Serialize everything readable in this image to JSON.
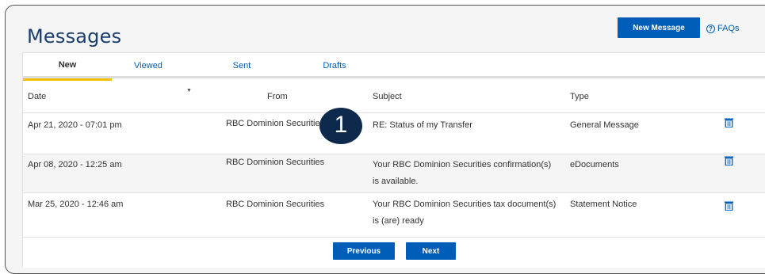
{
  "header": {
    "title": "Messages",
    "new_message_label": "New Message",
    "faq_label": "FAQs"
  },
  "tabs": [
    {
      "label": "New",
      "active": true
    },
    {
      "label": "Viewed",
      "active": false
    },
    {
      "label": "Sent",
      "active": false
    },
    {
      "label": "Drafts",
      "active": false
    }
  ],
  "table": {
    "columns": [
      "Date",
      "From",
      "Subject",
      "Type"
    ],
    "rows": [
      {
        "date": "Apr 21, 2020 - 07:01 pm",
        "from": "RBC Dominion Securities",
        "subject_line1": "RE: Status of my Transfer",
        "subject_line2": "",
        "type": "General Message"
      },
      {
        "date": "Apr 08, 2020 - 12:25 am",
        "from": "RBC Dominion Securities",
        "subject_line1": "Your RBC Dominion Securities confirmation(s)",
        "subject_line2": "is available.",
        "type": "eDocuments"
      },
      {
        "date": "Mar 25, 2020 - 12:46 am",
        "from": "RBC Dominion Securities",
        "subject_line1": "Your RBC Dominion Securities tax document(s)",
        "subject_line2": "is (are) ready",
        "type": "Statement Notice"
      }
    ]
  },
  "callout": {
    "number": "1"
  },
  "pager": {
    "previous_label": "Previous",
    "next_label": "Next"
  },
  "icons": {
    "delete": "trash-icon",
    "help": "question-circle-icon",
    "sort": "sort-caret-down-icon"
  },
  "colors": {
    "brand_blue": "#005eb8",
    "title_navy": "#1a3c6e",
    "tab_active": "#f2c200",
    "callout": "#0d2a4c"
  }
}
